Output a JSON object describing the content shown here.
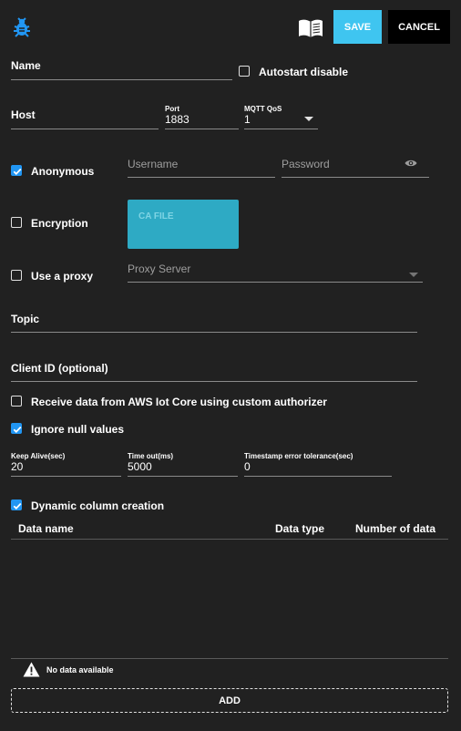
{
  "header": {
    "save_label": "SAVE",
    "cancel_label": "CANCEL"
  },
  "form": {
    "name_label": "Name",
    "autostart_label": "Autostart disable",
    "autostart_checked": false,
    "host_label": "Host",
    "port_label": "Port",
    "port_value": "1883",
    "qos_label": "MQTT QoS",
    "qos_value": "1",
    "anonymous_label": "Anonymous",
    "anonymous_checked": true,
    "username_placeholder": "Username",
    "password_placeholder": "Password",
    "encryption_label": "Encryption",
    "encryption_checked": false,
    "ca_file_label": "CA FILE",
    "proxy_label": "Use a proxy",
    "proxy_checked": false,
    "proxy_server_placeholder": "Proxy Server",
    "topic_label": "Topic",
    "client_id_label": "Client ID (optional)",
    "aws_label": "Receive data from AWS Iot Core using custom authorizer",
    "aws_checked": false,
    "ignore_null_label": "Ignore null values",
    "ignore_null_checked": true,
    "keep_alive_label": "Keep Alive(sec)",
    "keep_alive_value": "20",
    "timeout_label": "Time out(ms)",
    "timeout_value": "5000",
    "timestamp_tol_label": "Timestamp error tolerance(sec)",
    "timestamp_tol_value": "0",
    "dynamic_column_label": "Dynamic column creation",
    "dynamic_column_checked": true
  },
  "table": {
    "columns": [
      "Data name",
      "Data type",
      "Number of data"
    ],
    "empty_message": "No data available",
    "add_label": "ADD"
  },
  "icons": {
    "logo": "bug-icon",
    "docs": "open-book-icon",
    "password_toggle": "eye-icon",
    "warning": "warning-icon"
  },
  "colors": {
    "background": "#212121",
    "accent": "#2196f3",
    "save_button": "#3fc5f0",
    "ca_file_button": "#2eaac4"
  }
}
